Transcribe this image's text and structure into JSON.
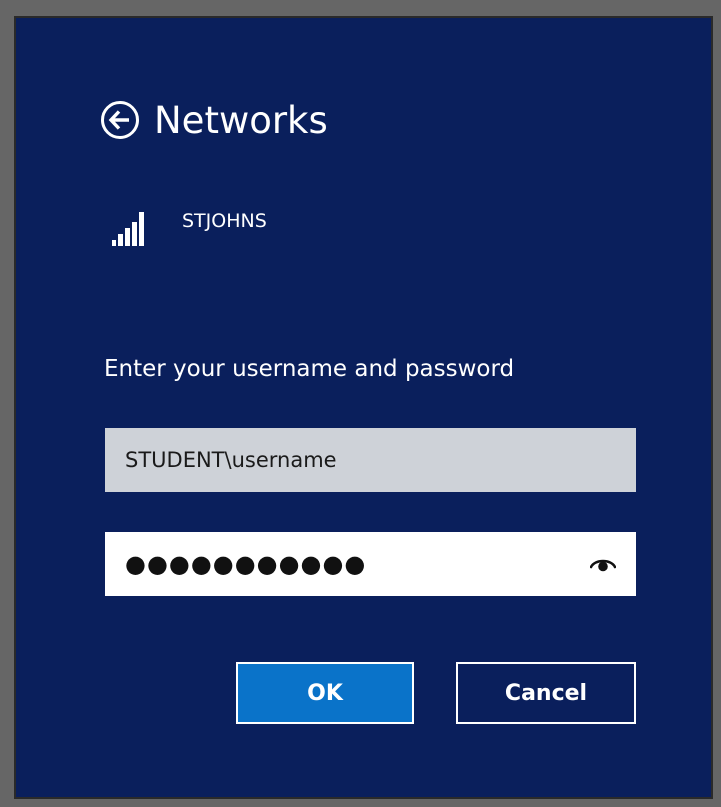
{
  "header": {
    "title": "Networks",
    "back_icon": "back-arrow-icon"
  },
  "network": {
    "name": "STJOHNS",
    "signal_icon": "wifi-signal-icon",
    "signal_strength": "4/5"
  },
  "login": {
    "prompt": "Enter your username and password",
    "username_value": "STUDENT\\username",
    "password_masked": "●●●●●●●●●●●",
    "reveal_icon": "eye-icon"
  },
  "buttons": {
    "ok_label": "OK",
    "cancel_label": "Cancel"
  },
  "colors": {
    "panel_bg": "#0a1f5c",
    "ok_accent": "#0a73c9",
    "username_field_bg": "#ced2d8"
  }
}
